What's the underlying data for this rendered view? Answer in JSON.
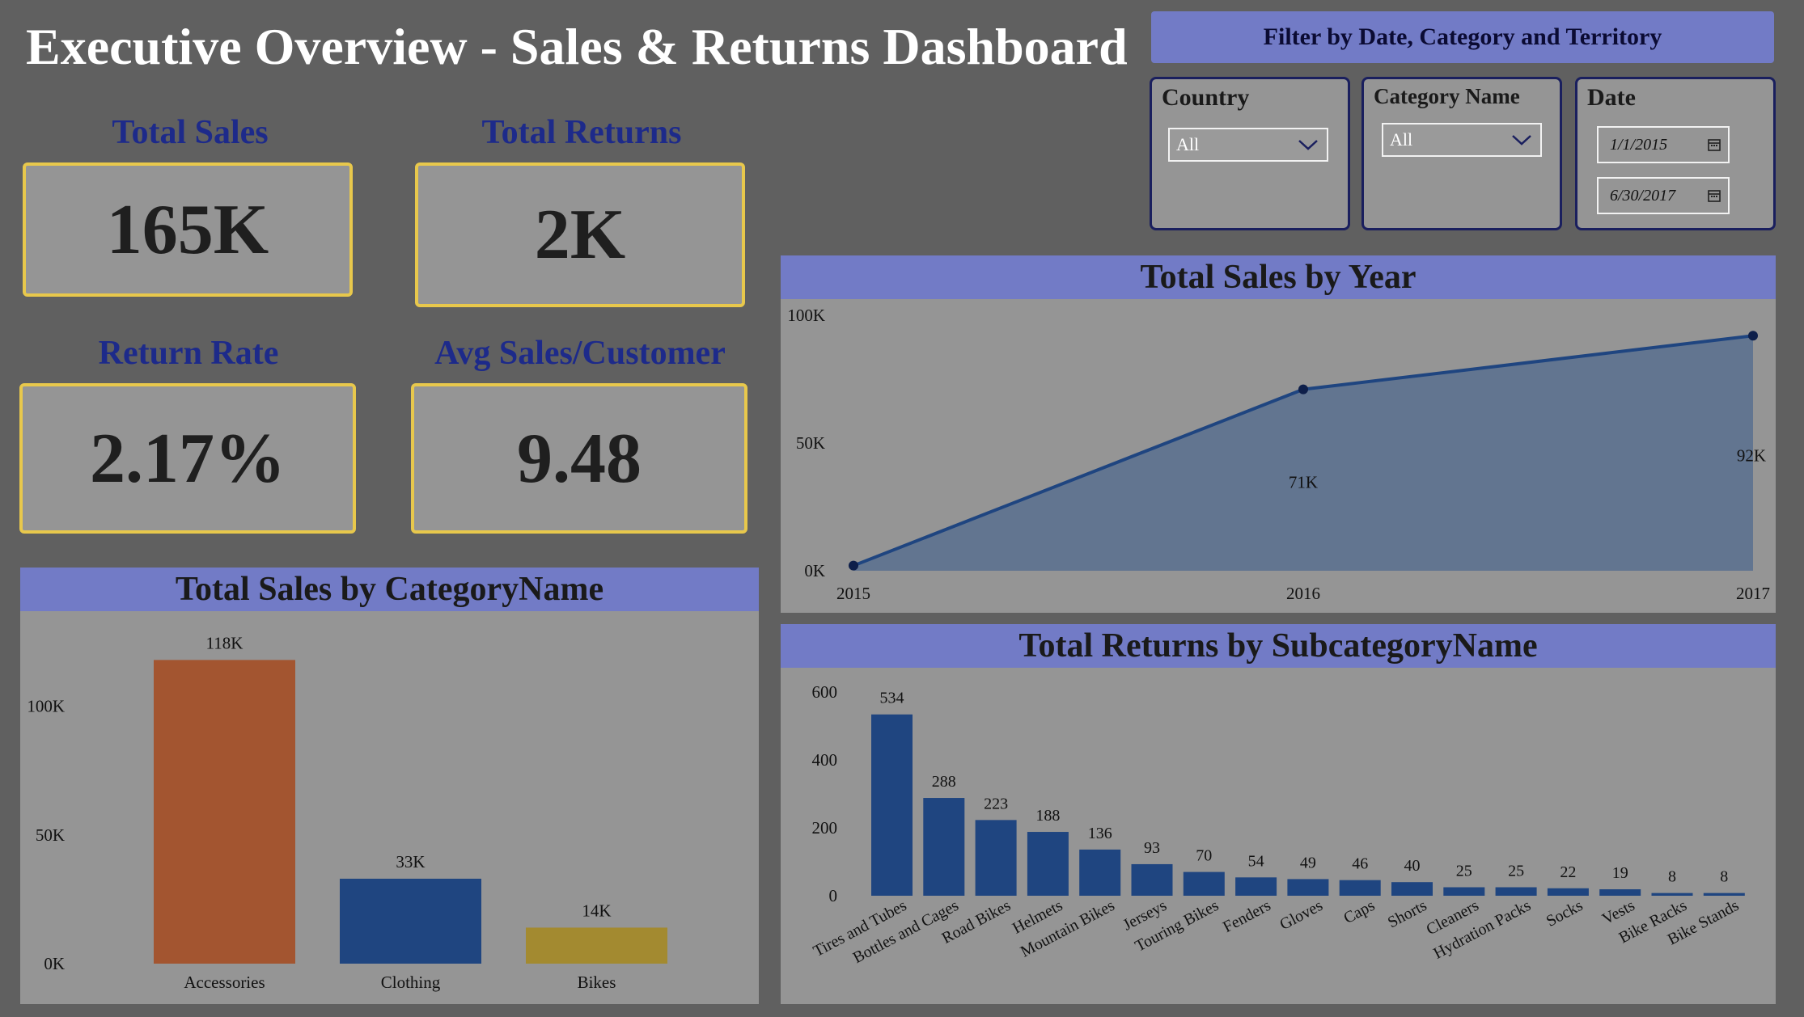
{
  "header": {
    "title": "Executive Overview - Sales & Returns Dashboard"
  },
  "filters": {
    "banner": "Filter by Date, Category and Territory",
    "country": {
      "label": "Country",
      "value": "All"
    },
    "category": {
      "label": "Category Name",
      "value": "All"
    },
    "date": {
      "label": "Date",
      "start": "1/1/2015",
      "end": "6/30/2017"
    }
  },
  "kpis": {
    "total_sales": {
      "label": "Total Sales",
      "value": "165K"
    },
    "total_returns": {
      "label": "Total Returns",
      "value": "2K"
    },
    "return_rate": {
      "label": "Return Rate",
      "value": "2.17%"
    },
    "avg_sales": {
      "label": "Avg Sales/Customer",
      "value": "9.48"
    }
  },
  "chart_data": [
    {
      "id": "year",
      "type": "area",
      "title": "Total Sales by Year",
      "x": [
        "2015",
        "2016",
        "2017"
      ],
      "values": [
        2,
        71,
        92
      ],
      "data_labels": [
        "",
        "71K",
        "92K"
      ],
      "yticks": [
        "0K",
        "50K",
        "100K"
      ],
      "ylim": [
        0,
        100
      ],
      "color": "#1f4580"
    },
    {
      "id": "category",
      "type": "bar",
      "title": "Total Sales by CategoryName",
      "categories": [
        "Accessories",
        "Clothing",
        "Bikes"
      ],
      "values": [
        118,
        33,
        14
      ],
      "data_labels": [
        "118K",
        "33K",
        "14K"
      ],
      "colors": [
        "#a35530",
        "#1f4580",
        "#a38a30"
      ],
      "yticks": [
        "0K",
        "50K",
        "100K"
      ],
      "ylim": [
        0,
        120
      ]
    },
    {
      "id": "subcategory",
      "type": "bar",
      "title": "Total Returns by SubcategoryName",
      "categories": [
        "Tires and Tubes",
        "Bottles and Cages",
        "Road Bikes",
        "Helmets",
        "Mountain Bikes",
        "Jerseys",
        "Touring Bikes",
        "Fenders",
        "Gloves",
        "Caps",
        "Shorts",
        "Cleaners",
        "Hydration Packs",
        "Socks",
        "Vests",
        "Bike Racks",
        "Bike Stands"
      ],
      "values": [
        534,
        288,
        223,
        188,
        136,
        93,
        70,
        54,
        49,
        46,
        40,
        25,
        25,
        22,
        19,
        8,
        8
      ],
      "yticks": [
        "0",
        "200",
        "400",
        "600"
      ],
      "ylim": [
        0,
        600
      ],
      "color": "#1f4580"
    }
  ]
}
